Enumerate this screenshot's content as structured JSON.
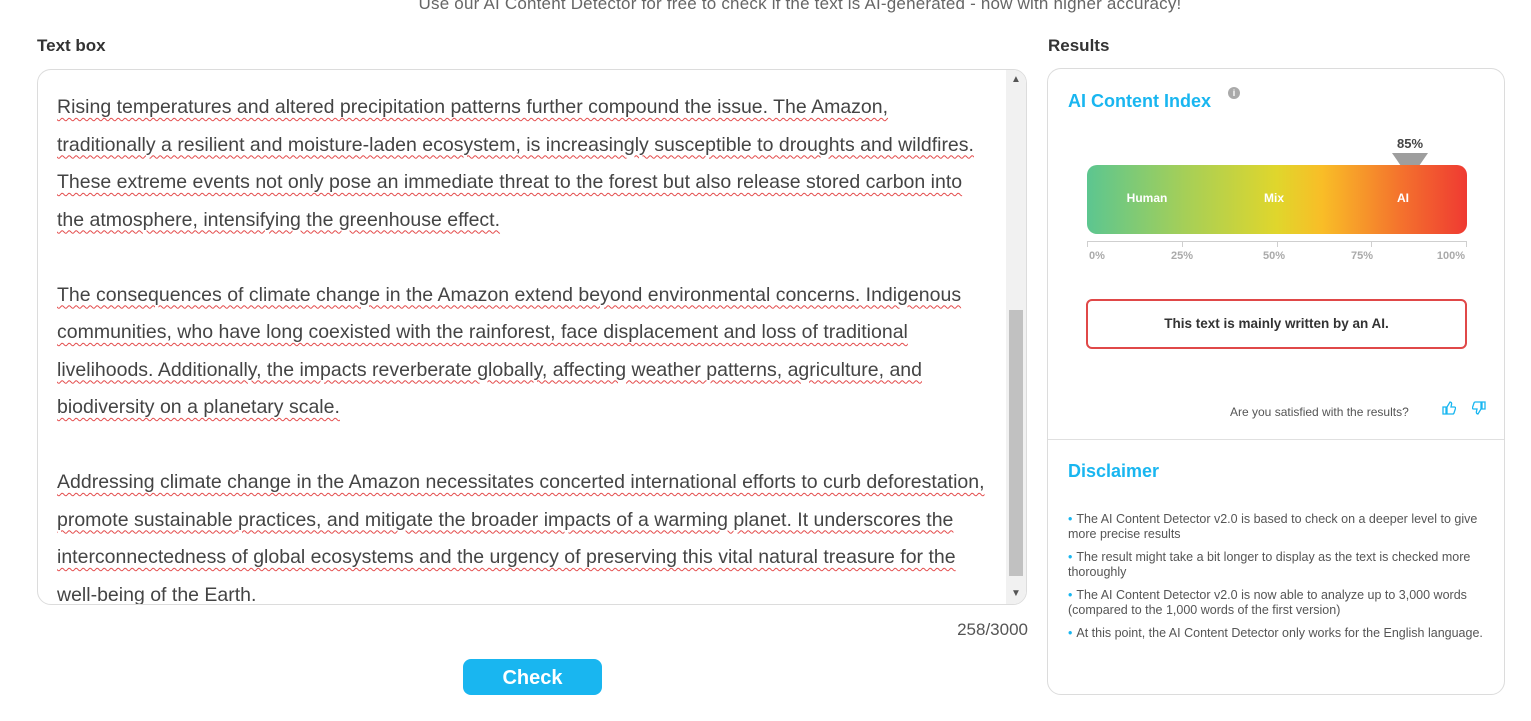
{
  "header": {
    "subtitle": "Use our AI Content Detector for free to check if the text is AI-generated - now with higher accuracy!"
  },
  "text_box": {
    "label": "Text box",
    "paragraphs": [
      "Rising temperatures and altered precipitation patterns further compound the issue. The Amazon, traditionally a resilient and moisture-laden ecosystem, is increasingly susceptible to droughts and wildfires. These extreme events not only pose an immediate threat to the forest but also release stored carbon into the atmosphere, intensifying the greenhouse effect.",
      "The consequences of climate change in the Amazon extend beyond environmental concerns. Indigenous communities, who have long coexisted with the rainforest, face displacement and loss of traditional livelihoods. Additionally, the impacts reverberate globally, affecting weather patterns, agriculture, and biodiversity on a planetary scale.",
      "Addressing climate change in the Amazon necessitates concerted international efforts to curb deforestation, promote sustainable practices, and mitigate the broader impacts of a warming planet. It underscores the interconnectedness of global ecosystems and the urgency of preserving this vital natural treasure for the well-being of the Earth."
    ],
    "word_count": "258/3000",
    "check_label": "Check"
  },
  "results": {
    "label": "Results",
    "ai_index_title": "AI Content Index",
    "info_icon": "i",
    "score_label": "85%",
    "score_fraction": 0.85,
    "gauge_labels": [
      "Human",
      "Mix",
      "AI"
    ],
    "axis_labels": [
      "0%",
      "25%",
      "50%",
      "75%",
      "100%"
    ],
    "verdict": "This text is mainly written by an AI.",
    "feedback_prompt": "Are you satisfied with the results?",
    "thumbs_up_icon": "thumbs-up-icon",
    "thumbs_down_icon": "thumbs-down-icon",
    "disclaimer_title": "Disclaimer",
    "disclaimer_items": [
      "The AI Content Detector v2.0 is based to check on a deeper level to give more precise results",
      "The result might take a bit longer to display as the text is checked more thoroughly",
      "The AI Content Detector v2.0 is now able to analyze up to 3,000 words (compared to the 1,000 words of the first version)",
      "At this point, the AI Content Detector only works for the English language."
    ],
    "colors": {
      "accent": "#19b6f0",
      "verdict_border": "#e04848",
      "gauge_start": "#5cc690",
      "gauge_end": "#ef3a32"
    }
  }
}
